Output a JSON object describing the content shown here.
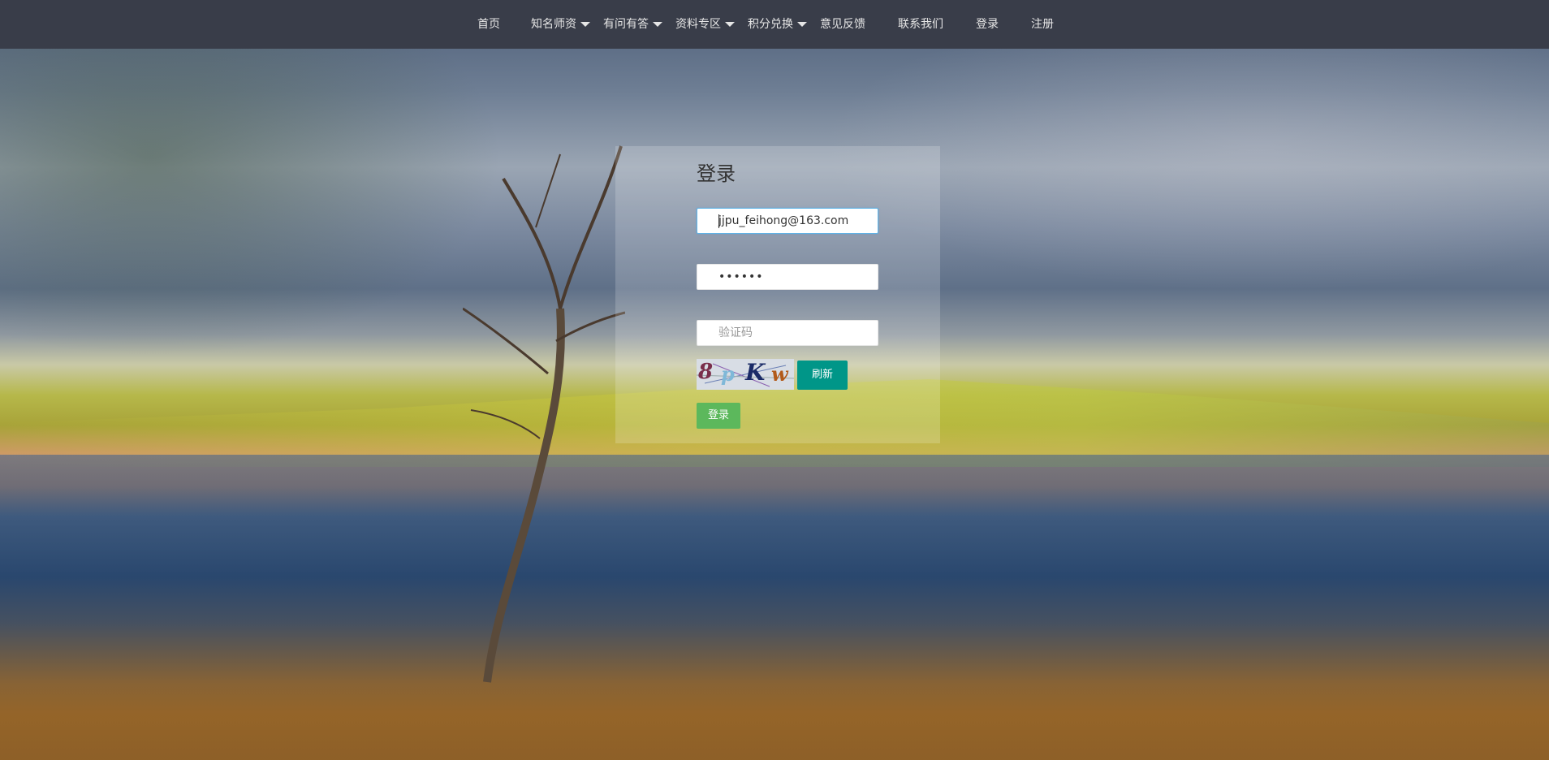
{
  "nav": {
    "items": [
      {
        "label": "首页",
        "dropdown": false
      },
      {
        "label": "知名师资",
        "dropdown": true
      },
      {
        "label": "有问有答",
        "dropdown": true
      },
      {
        "label": "资料专区",
        "dropdown": true
      },
      {
        "label": "积分兑换",
        "dropdown": true
      },
      {
        "label": "意见反馈",
        "dropdown": false
      },
      {
        "label": "联系我们",
        "dropdown": false
      },
      {
        "label": "登录",
        "dropdown": false
      },
      {
        "label": "注册",
        "dropdown": false
      }
    ]
  },
  "login": {
    "title": "登录",
    "email_value": "jjpu_feihong@163.com",
    "password_value": "••••••",
    "captcha_placeholder": "验证码",
    "captcha_chars": [
      "8",
      "p",
      "K",
      "w"
    ],
    "refresh_label": "刷新",
    "submit_label": "登录"
  },
  "colors": {
    "navbar": "#393d49",
    "refresh_button": "#009688",
    "login_button": "#5cb85c"
  }
}
